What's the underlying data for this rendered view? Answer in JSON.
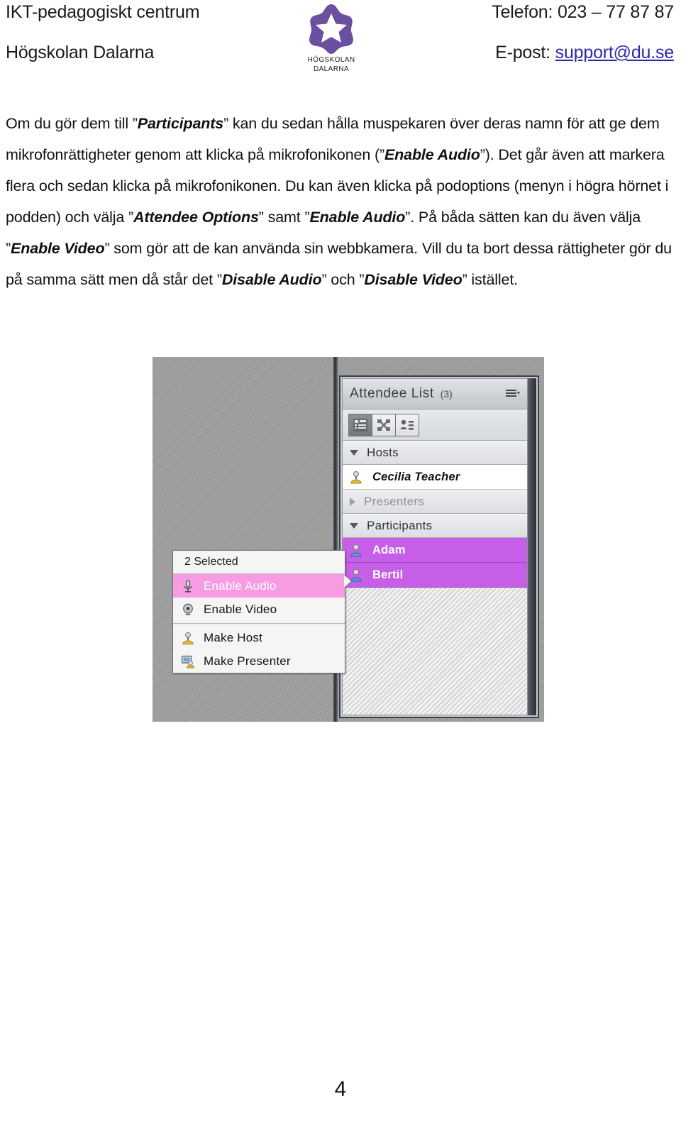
{
  "document": {
    "page_number": "4"
  },
  "header": {
    "org_unit": "IKT-pedagogiskt centrum",
    "institution": "Högskolan Dalarna",
    "phone_label": "Telefon: 023 – 77 87 87",
    "email_label": "E-post:",
    "email_address": "support@du.se",
    "logo": {
      "icon": "star-logo-icon",
      "line1": "HÖGSKOLAN",
      "line2": "DALARNA",
      "color": "#6b4fa0"
    }
  },
  "body": {
    "paragraph_html": "Om du gör dem till ”<b>Participants</b>” kan du sedan hålla muspekaren över deras namn för att ge dem mikrofonrättigheter genom att klicka på mikrofonikonen (”<b>Enable Audio</b>”). Det går även att markera flera och sedan klicka på mikrofonikonen. Du kan även klicka på podoptions (menyn i högra hörnet i podden) och välja ”<b>Attendee Options</b>” samt ”<b>Enable Audio</b>”. På båda sätten kan du även välja ”<b>Enable Video</b>” som gör att de kan använda sin webbkamera. Vill du ta bort dessa rättigheter gör du på samma sätt men då står det ”<b>Disable Audio</b>” och ”<b>Disable Video</b>” istället."
  },
  "screenshot": {
    "attendee_pod": {
      "title": "Attendee List",
      "count": "(3)",
      "pod_options_icon": "pod-options-menu-icon",
      "toolbar": [
        {
          "icon": "attendee-list-view-icon",
          "active": true
        },
        {
          "icon": "breakout-rooms-icon",
          "active": false
        },
        {
          "icon": "attendee-details-icon",
          "active": false
        }
      ],
      "groups": [
        {
          "label": "Hosts",
          "expanded": true,
          "members": [
            {
              "name": "Cecilia Teacher",
              "icon": "host-avatar-icon",
              "selected": false,
              "role": "host"
            }
          ]
        },
        {
          "label": "Presenters",
          "expanded": false,
          "members": []
        },
        {
          "label": "Participants",
          "expanded": true,
          "members": [
            {
              "name": "Adam",
              "icon": "participant-avatar-icon",
              "selected": true,
              "role": "participant"
            },
            {
              "name": "Bertil",
              "icon": "participant-avatar-icon",
              "selected": true,
              "role": "participant"
            }
          ]
        }
      ]
    },
    "context_menu": {
      "header": "2 Selected",
      "items": [
        {
          "label": "Enable Audio",
          "icon": "microphone-icon",
          "highlighted": true
        },
        {
          "label": "Enable Video",
          "icon": "webcam-icon",
          "highlighted": false
        },
        {
          "label": "Make Host",
          "icon": "host-avatar-icon",
          "highlighted": false
        },
        {
          "label": "Make Presenter",
          "icon": "presenter-screen-icon",
          "highlighted": false
        }
      ]
    },
    "colors": {
      "selection_purple": "#c75ee8",
      "menu_highlight_pink": "#f79ce2",
      "stage_gray": "#9a9a9a",
      "pod_chrome": "#3b4049"
    }
  }
}
